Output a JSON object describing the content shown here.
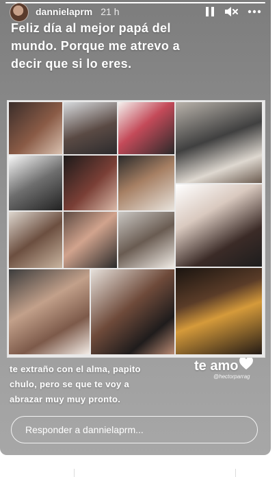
{
  "story": {
    "username": "dannielaprm",
    "time_ago": "21 h",
    "progress_fraction": 1.0,
    "caption": "Feliz día al mejor papá del mundo. Porque me atrevo a decir que si lo eres.",
    "note": "te extraño con el alma, papito chulo, pero se que te voy a abrazar muy muy pronto.",
    "love_text": "te amo",
    "mention": "@hectorparrag",
    "reply_placeholder": "Responder a dannielaprm..."
  },
  "icons": {
    "pause": "pause-icon",
    "mute": "mute-icon",
    "more": "more-icon",
    "heart": "heart-icon"
  },
  "colors": {
    "text": "#ffffff",
    "story_bg": "#8b8b8b",
    "collage_bg": "#e9e9e9"
  }
}
